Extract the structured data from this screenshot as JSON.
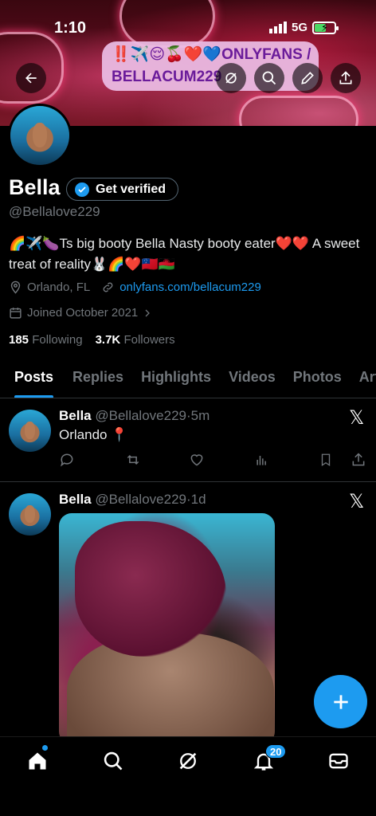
{
  "status_bar": {
    "time": "1:10",
    "network": "5G"
  },
  "banner_text": {
    "line1": "‼️✈️😌🍒❤️💙ONLYFANS /",
    "line2": "BELLACUM229"
  },
  "profile": {
    "name": "Bella",
    "verify_label": "Get verified",
    "handle": "@Bellalove229",
    "bio": "🌈✈️🍆Ts big booty Bella Nasty booty eater❤️❤️ A sweet treat of reality🐰🌈❤️🇼🇸🇲🇼",
    "location": "Orlando, FL",
    "link": "onlyfans.com/bellacum229",
    "joined": "Joined October 2021",
    "following_count": "185",
    "following_label": "Following",
    "followers_count": "3.7K",
    "followers_label": "Followers"
  },
  "tabs": [
    "Posts",
    "Replies",
    "Highlights",
    "Videos",
    "Photos",
    "Articles"
  ],
  "posts": [
    {
      "name": "Bella",
      "handle": "@Bellalove229",
      "time": "5m",
      "text": "Orlando 📍"
    },
    {
      "name": "Bella",
      "handle": "@Bellalove229",
      "time": "1d",
      "text": ""
    }
  ],
  "notifications_badge": "20",
  "colors": {
    "accent": "#1d9bf0",
    "background": "#000000",
    "muted": "#71767b"
  }
}
